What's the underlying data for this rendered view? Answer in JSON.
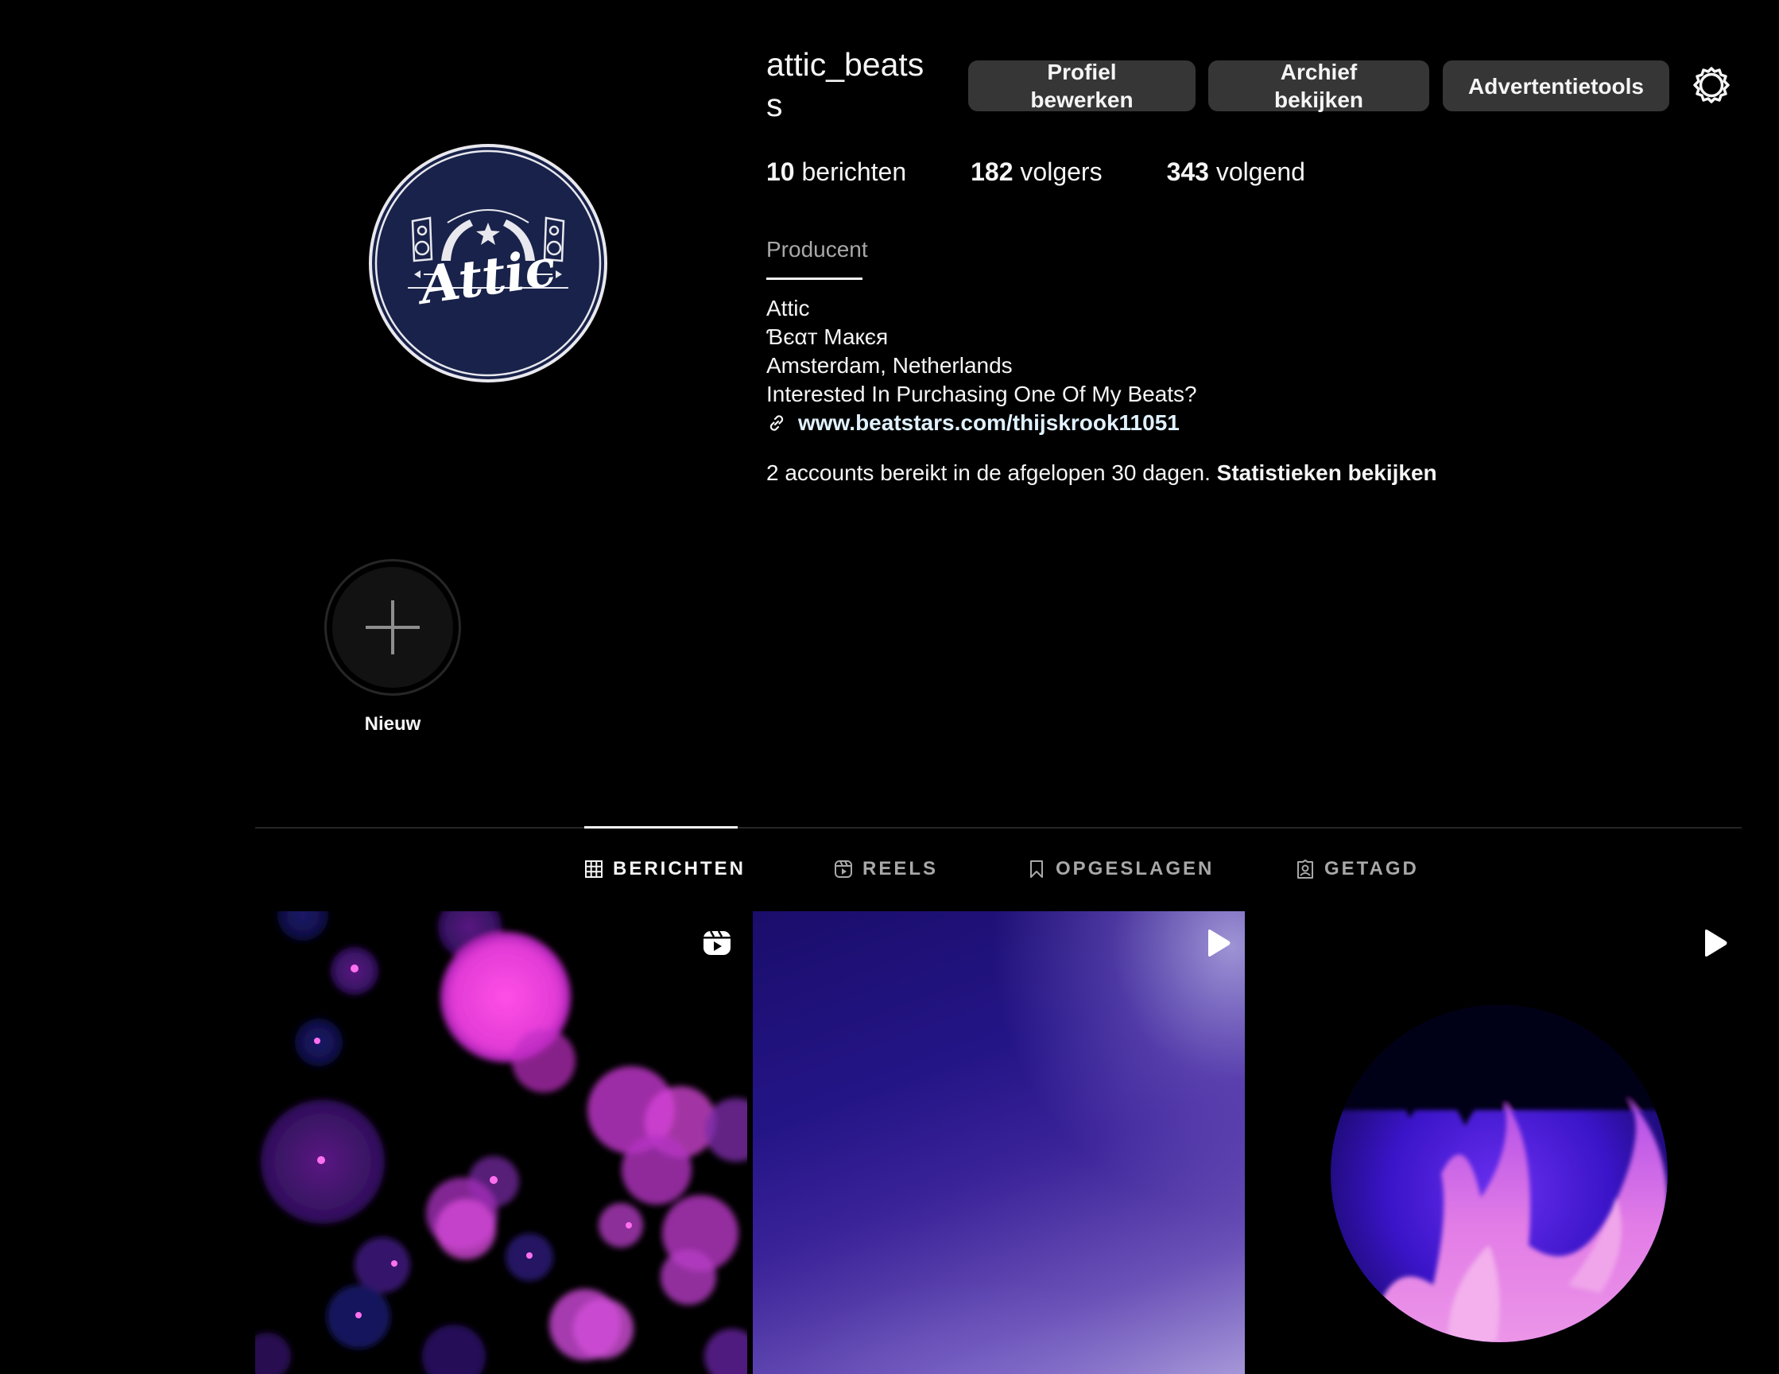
{
  "profile": {
    "username": "attic_beats​s",
    "avatar": {
      "icon": "attic-logo-icon",
      "logo_text": "Attic",
      "colors": {
        "ring": "#e8e8ee",
        "fill": "#18224a"
      }
    },
    "buttons": {
      "edit_line1": "Profiel",
      "edit_line2": "bewerken",
      "archive_line1": "Archief",
      "archive_line2": "bekijken",
      "ads": "Advertentietools"
    },
    "settings_icon": "gear-icon",
    "stats": {
      "posts_count": "10",
      "posts_label": "berichten",
      "followers_count": "182",
      "followers_label": "volgers",
      "following_count": "343",
      "following_label": "volgend"
    },
    "category": "Producent",
    "bio_lines": [
      "Attic",
      "Ɓєαт Макєя",
      "Amsterdam, Netherlands",
      "Interested In Purchasing One Of My Beats?"
    ],
    "link": "www.beatstars.com/thijskrook11051",
    "reach_text": "2 accounts bereikt in de afgelopen 30 dagen.",
    "reach_link": "Statistieken bekijken"
  },
  "highlights": {
    "new_label": "Nieuw",
    "new_icon": "plus-icon"
  },
  "tabs": [
    {
      "label": "BERICHTEN",
      "icon": "grid-icon",
      "active": true
    },
    {
      "label": "REELS",
      "icon": "reels-icon",
      "active": false
    },
    {
      "label": "OPGESLAGEN",
      "icon": "bookmark-icon",
      "active": false
    },
    {
      "label": "GETAGD",
      "icon": "tagged-icon",
      "active": false
    }
  ],
  "posts": [
    {
      "type": "reel",
      "badge_icon": "reels-icon"
    },
    {
      "type": "video",
      "badge_icon": "play-icon"
    },
    {
      "type": "video",
      "badge_icon": "play-icon"
    }
  ],
  "colors": {
    "background": "#000000",
    "button_bg": "#363636",
    "text_primary": "#f5f5f5",
    "text_secondary": "#a8a8a8",
    "link": "#e0f1ff"
  }
}
